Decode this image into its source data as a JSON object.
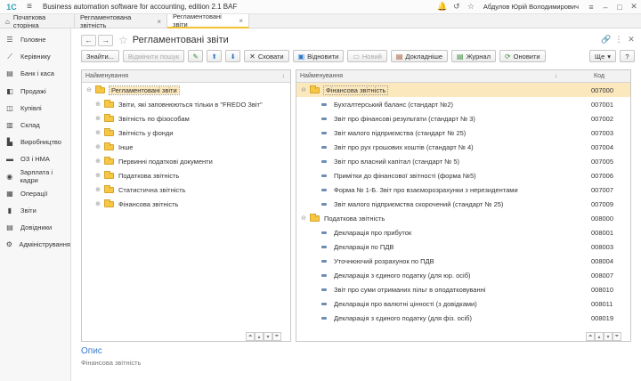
{
  "app": {
    "logo": "1С",
    "title": "Business automation software for accounting, edition 2.1 BAF",
    "user": "Абдулов Юрій Володимирович"
  },
  "tabs": [
    {
      "label": "Початкова сторінка",
      "icon": "home-icon"
    },
    {
      "label": "Регламентована звітність",
      "icon": "close-icon"
    },
    {
      "label": "Регламентовані звіти",
      "icon": "close-icon"
    }
  ],
  "sidebar": {
    "items": [
      {
        "label": "Головне",
        "icon": "menu-icon"
      },
      {
        "label": "Керівнику",
        "icon": "chart-line-icon"
      },
      {
        "label": "Банк і каса",
        "icon": "bank-icon"
      },
      {
        "label": "Продажі",
        "icon": "bag-icon"
      },
      {
        "label": "Купівлі",
        "icon": "cart-icon"
      },
      {
        "label": "Склад",
        "icon": "warehouse-icon"
      },
      {
        "label": "Виробництво",
        "icon": "factory-icon"
      },
      {
        "label": "ОЗ і НМА",
        "icon": "truck-icon"
      },
      {
        "label": "Зарплата і кадри",
        "icon": "people-icon"
      },
      {
        "label": "Операції",
        "icon": "operations-icon"
      },
      {
        "label": "Звіти",
        "icon": "bar-chart-icon"
      },
      {
        "label": "Довідники",
        "icon": "book-icon"
      },
      {
        "label": "Адміністрування",
        "icon": "gear-icon"
      }
    ]
  },
  "page": {
    "title": "Регламентовані звіти"
  },
  "toolbar": {
    "find": "Знайти...",
    "cancel_search": "Відмінити пошук",
    "hide": "Сховати",
    "show": "Відновити",
    "new": "Новий",
    "details": "Докладніше",
    "journal": "Журнал",
    "refresh": "Оновити",
    "more": "Ще"
  },
  "left_panel": {
    "header": "Найменування",
    "root": "Регламентовані звіти",
    "items": [
      "Звіти, які заповнюються тільки в \"FREDO Звіт\"",
      "Звітність по фізособам",
      "Звітність у фонди",
      "Інше",
      "Первинні податкові документи",
      "Податкова звітність",
      "Статистична звітність",
      "Фінансова звітність"
    ]
  },
  "right_panel": {
    "header_name": "Найменування",
    "header_code": "Код",
    "rows": [
      {
        "type": "folder",
        "name": "Фінансова звітність",
        "code": "007000",
        "selected": true
      },
      {
        "type": "doc",
        "name": "Бухгалтерський баланс (стандарт №2)",
        "code": "007001"
      },
      {
        "type": "doc",
        "name": "Звіт про фінансові результати (стандарт № 3)",
        "code": "007002"
      },
      {
        "type": "doc",
        "name": "Звіт малого підприємства (стандарт № 25)",
        "code": "007003"
      },
      {
        "type": "doc",
        "name": "Звіт про рух грошових коштів (стандарт № 4)",
        "code": "007004"
      },
      {
        "type": "doc",
        "name": "Звіт про власний капітал (стандарт № 5)",
        "code": "007005"
      },
      {
        "type": "doc",
        "name": "Примітки до фінансової звітності (форма №5)",
        "code": "007006"
      },
      {
        "type": "doc",
        "name": "Форма № 1-Б. Звіт про взаєморозрахунки з нерезидентами",
        "code": "007007"
      },
      {
        "type": "doc",
        "name": "Звіт малого підприємства скорочений (стандарт № 25)",
        "code": "007009"
      },
      {
        "type": "folder",
        "name": "Податкова звітність",
        "code": "008000"
      },
      {
        "type": "doc",
        "name": "Декларація про прибуток",
        "code": "008001"
      },
      {
        "type": "doc",
        "name": "Декларація по ПДВ",
        "code": "008003"
      },
      {
        "type": "doc",
        "name": "Уточнюючий розрахунок по ПДВ",
        "code": "008004"
      },
      {
        "type": "doc",
        "name": "Декларація з єдиного податку (для юр. осіб)",
        "code": "008007"
      },
      {
        "type": "doc",
        "name": "Звіт про суми отриманих пільг в оподатковуванні",
        "code": "008010"
      },
      {
        "type": "doc",
        "name": "Декларація про валютні цінності (з довідками)",
        "code": "008011"
      },
      {
        "type": "doc",
        "name": "Декларація з єдиного податку (для фіз. осіб)",
        "code": "008019"
      }
    ]
  },
  "description": {
    "title": "Опис",
    "text": "Фінансова звітність"
  }
}
